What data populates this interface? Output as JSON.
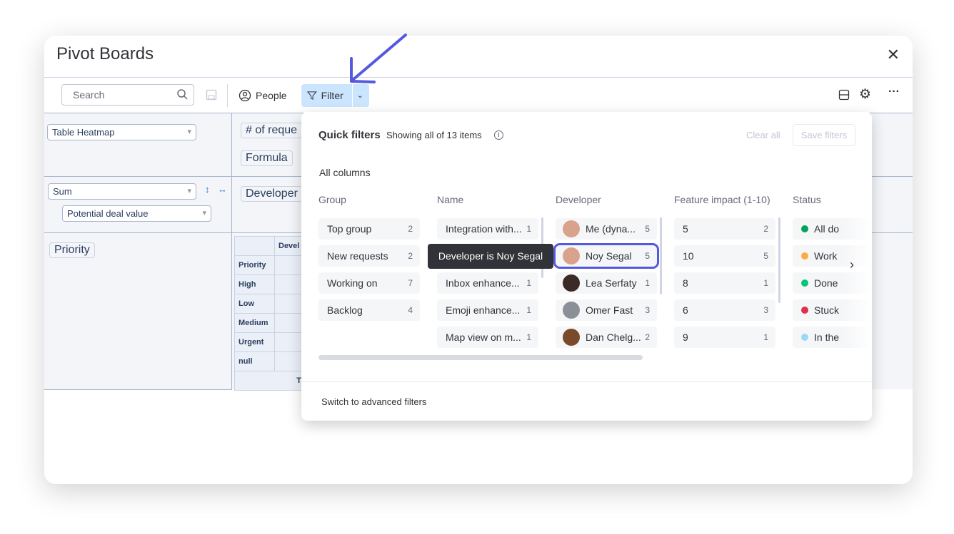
{
  "window": {
    "title": "Pivot Boards"
  },
  "toolbar": {
    "search_placeholder": "Search",
    "people_label": "People",
    "filter_label": "Filter"
  },
  "pivot": {
    "renderer": "Table Heatmap",
    "aggregator": "Sum",
    "aggregator_field": "Potential deal value",
    "value_pill": "# of reque",
    "formula_pill": "Formula",
    "col_pill": "Developer",
    "row_pill": "Priority",
    "table_header": "Devel",
    "row_header": "Priority",
    "rows": [
      "High",
      "Low",
      "Medium",
      "Urgent",
      "null"
    ],
    "total_label": "T"
  },
  "filters": {
    "title": "Quick filters",
    "subtitle": "Showing all of 13 items",
    "clear_all": "Clear all",
    "save_filters": "Save filters",
    "all_columns": "All columns",
    "tooltip": "Developer is Noy Segal",
    "advanced": "Switch to advanced filters",
    "columns": [
      {
        "header": "Group",
        "items": [
          {
            "label": "Top group",
            "count": "2"
          },
          {
            "label": "New requests",
            "count": "2"
          },
          {
            "label": "Working on",
            "count": "7"
          },
          {
            "label": "Backlog",
            "count": "4"
          }
        ]
      },
      {
        "header": "Name",
        "items": [
          {
            "label": "Integration with...",
            "count": "1"
          },
          {
            "label": "",
            "count": ""
          },
          {
            "label": "Inbox enhance...",
            "count": "1"
          },
          {
            "label": "Emoji enhance...",
            "count": "1"
          },
          {
            "label": "Map view on m...",
            "count": "1"
          }
        ]
      },
      {
        "header": "Developer",
        "items": [
          {
            "label": "Me (dyna...",
            "count": "5",
            "avatar": "#d9a38b"
          },
          {
            "label": "Noy Segal",
            "count": "5",
            "avatar": "#d9a38b",
            "selected": true
          },
          {
            "label": "Lea Serfaty",
            "count": "1",
            "avatar": "#3b2a26"
          },
          {
            "label": "Omer Fast",
            "count": "3",
            "avatar": "#8a8f98"
          },
          {
            "label": "Dan Chelg...",
            "count": "2",
            "avatar": "#7a4a2a"
          }
        ]
      },
      {
        "header": "Feature impact (1-10)",
        "items": [
          {
            "label": "5",
            "count": "2"
          },
          {
            "label": "10",
            "count": "5"
          },
          {
            "label": "8",
            "count": "1"
          },
          {
            "label": "6",
            "count": "3"
          },
          {
            "label": "9",
            "count": "1"
          }
        ]
      },
      {
        "header": "Status",
        "items": [
          {
            "label": "All do",
            "color": "#00a359"
          },
          {
            "label": "Work",
            "color": "#fdab3d"
          },
          {
            "label": "Done",
            "color": "#00c875"
          },
          {
            "label": "Stuck",
            "color": "#df2f4a"
          },
          {
            "label": "In the",
            "color": "#9ad8f5"
          }
        ]
      }
    ]
  },
  "colors": {
    "accent": "#5559df",
    "filter_bg": "#cce5ff"
  }
}
